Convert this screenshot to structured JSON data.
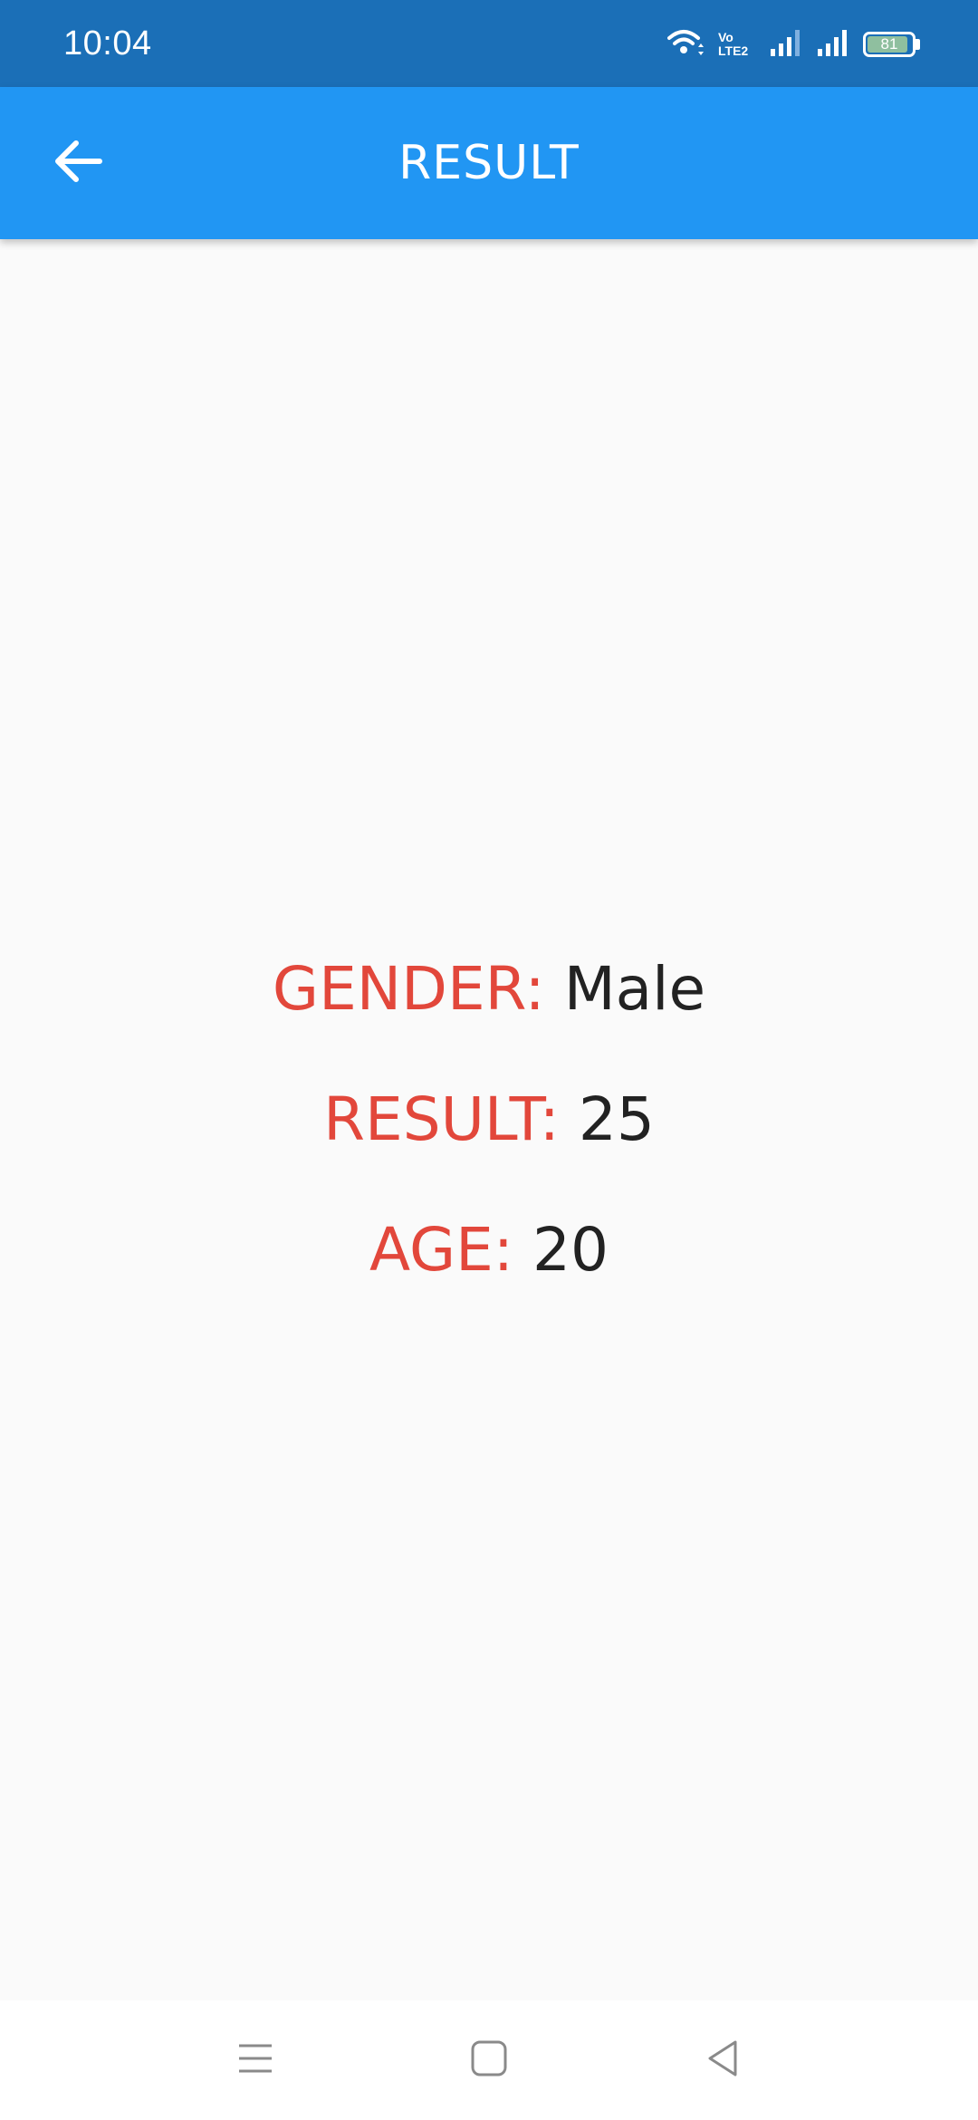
{
  "status_bar": {
    "time": "10:04",
    "volte_line1": "Vo",
    "volte_line2": "LTE2",
    "battery_level": "81",
    "icons": [
      "wifi-icon",
      "volte-icon",
      "signal-1-icon",
      "signal-2-icon",
      "battery-icon"
    ]
  },
  "app_bar": {
    "title": "RESULT",
    "back_icon": "arrow-back-icon",
    "color": "#2196f3"
  },
  "result": {
    "gender_label": "GENDER:",
    "gender_value": "Male",
    "result_label": "RESULT:",
    "result_value": "25",
    "age_label": "AGE:",
    "age_value": "20",
    "label_color": "#e2473b"
  },
  "nav_bar": {
    "icons": [
      "menu-lines-icon",
      "home-square-icon",
      "back-triangle-icon"
    ]
  }
}
